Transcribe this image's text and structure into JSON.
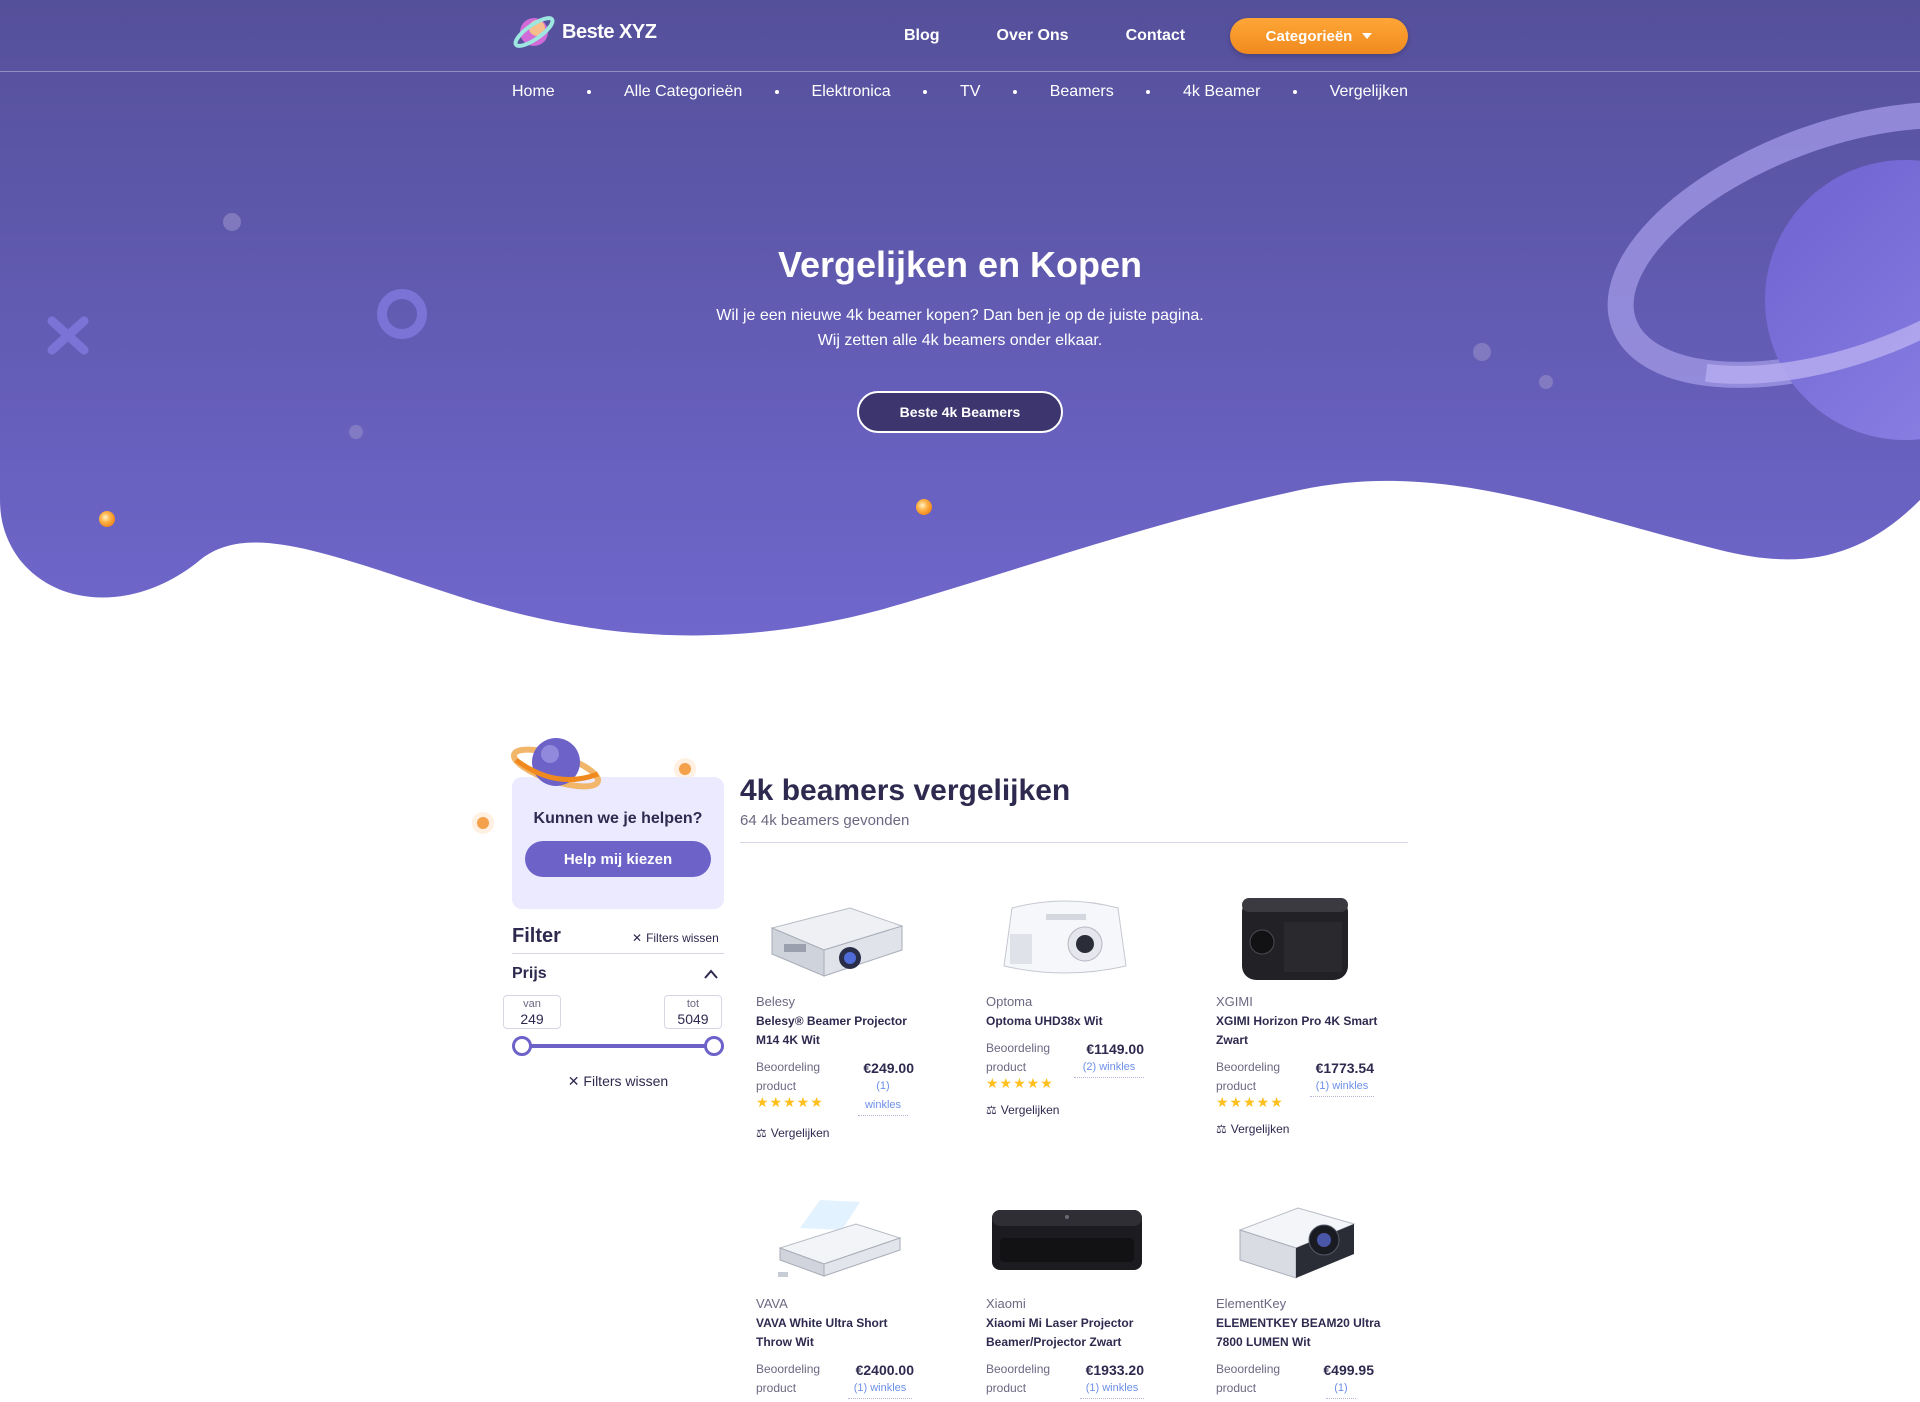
{
  "header": {
    "logo_text": "Beste XYZ",
    "nav": [
      "Blog",
      "Over Ons",
      "Contact"
    ],
    "categories_button": "Categorieën"
  },
  "breadcrumbs": [
    "Home",
    "Alle Categorieën",
    "Elektronica",
    "TV",
    "Beamers",
    "4k Beamer",
    "Vergelijken"
  ],
  "hero": {
    "title": "Vergelijken en Kopen",
    "subtitle_line1": "Wil je een nieuwe 4k beamer kopen? Dan ben je op de juiste pagina.",
    "subtitle_line2": "Wij zetten alle 4k beamers onder elkaar.",
    "button": "Beste 4k Beamers"
  },
  "sidebar": {
    "help_question": "Kunnen we je helpen?",
    "help_button": "Help mij kiezen",
    "filter_title": "Filter",
    "filters_clear": "Filters wissen",
    "price_label": "Prijs",
    "price_from_label": "van",
    "price_from": "249",
    "price_to_label": "tot",
    "price_to": "5049"
  },
  "main": {
    "title": "4k beamers vergelijken",
    "subtitle": "64 4k beamers gevonden"
  },
  "product_labels": {
    "rating_line1": "Beoordeling",
    "rating_line2": "product",
    "compare": "Vergelijken",
    "stars": "★★★★★"
  },
  "products": [
    {
      "brand": "Belesy",
      "name": "Belesy® Beamer Projector M14 4K Wit",
      "price": "€249.00",
      "shops": "(1) winkles",
      "shops_a": "(1)",
      "shops_b": "winkles"
    },
    {
      "brand": "Optoma",
      "name": "Optoma UHD38x Wit",
      "price": "€1149.00",
      "shops": "(2) winkles"
    },
    {
      "brand": "XGIMI",
      "name": "XGIMI Horizon Pro 4K Smart Zwart",
      "price": "€1773.54",
      "shops": "(1) winkles"
    },
    {
      "brand": "VAVA",
      "name": "VAVA White Ultra Short Throw Wit",
      "price": "€2400.00",
      "shops": "(1) winkles"
    },
    {
      "brand": "Xiaomi",
      "name": "Xiaomi Mi Laser Projector Beamer/Projector Zwart",
      "price": "€1933.20",
      "shops": "(1) winkles"
    },
    {
      "brand": "ElementKey",
      "name": "ELEMENTKEY BEAM20 Ultra 7800 LUMEN Wit",
      "price": "€499.95",
      "shops": "(1)"
    }
  ],
  "colors": {
    "hero_top": "#5a52a0",
    "hero_bottom": "#6f65c9",
    "accent_orange": "#f59a2b",
    "primary_purple": "#6c62c8",
    "text_dark": "#2e2a4f",
    "star": "#ffbf1c",
    "link_blue": "#6c8fe8"
  }
}
